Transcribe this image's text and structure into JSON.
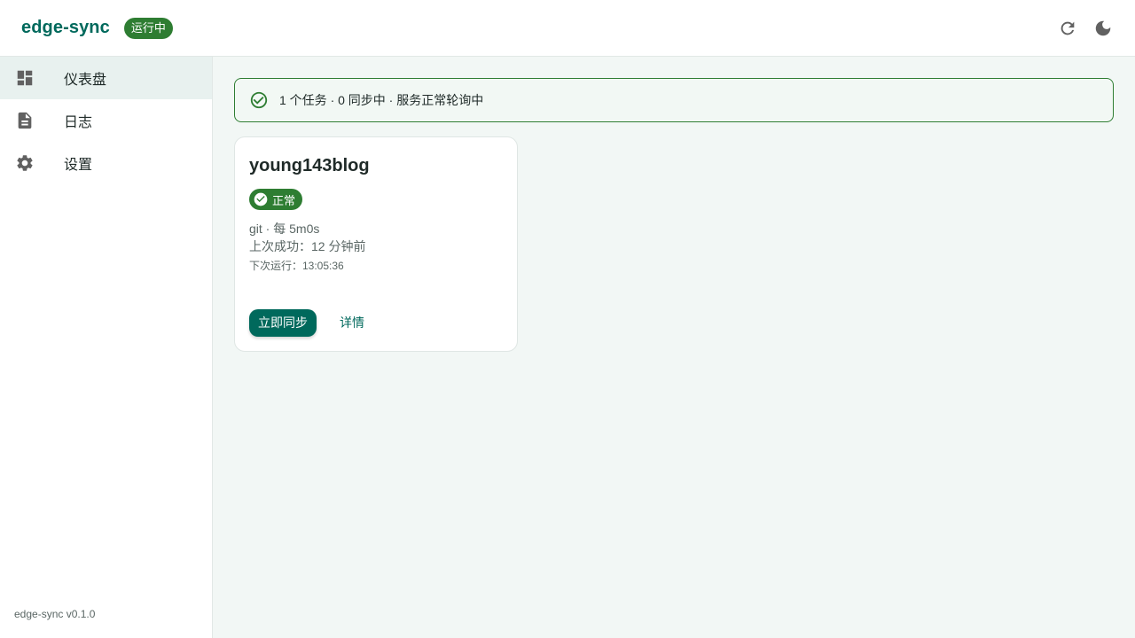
{
  "header": {
    "title": "edge-sync",
    "status": "运行中",
    "refresh_icon": "refresh-icon",
    "theme_icon": "dark-mode-icon"
  },
  "sidebar": {
    "items": [
      {
        "label": "仪表盘",
        "icon": "dashboard-icon",
        "active": true
      },
      {
        "label": "日志",
        "icon": "document-icon",
        "active": false
      },
      {
        "label": "设置",
        "icon": "gear-icon",
        "active": false
      }
    ],
    "footer": "edge-sync v0.1.0"
  },
  "main": {
    "alert": {
      "text": "1 个任务 · 0 同步中 · 服务正常轮询中",
      "icon": "check-circle-outline-icon"
    },
    "jobs": [
      {
        "name": "young143blog",
        "status": "正常",
        "status_icon": "check-circle-icon",
        "meta": "git · 每 5m0s",
        "last_success": "上次成功：12 分钟前",
        "next_run": "下次运行：13:05:36",
        "sync_label": "立即同步",
        "details_label": "详情"
      }
    ]
  },
  "colors": {
    "brand": "#00695c",
    "success": "#2e7d32",
    "background": "#f2f7f5"
  }
}
